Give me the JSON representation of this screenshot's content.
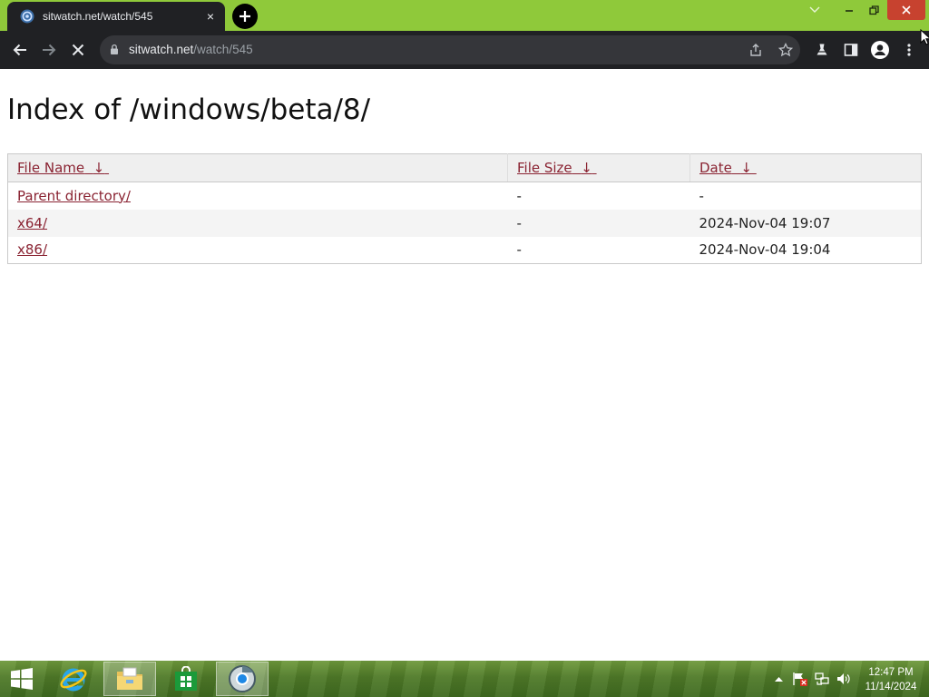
{
  "browser": {
    "tab_title": "sitwatch.net/watch/545",
    "tab_close": "×",
    "new_tab": "+",
    "url_host": "sitwatch.net",
    "url_path": "/watch/545"
  },
  "page": {
    "heading": "Index of /windows/beta/8/",
    "columns": [
      "File Name",
      "File Size",
      "Date"
    ],
    "sort_arrow": "↓",
    "rows": [
      {
        "name": "Parent directory/",
        "size": "-",
        "date": "-"
      },
      {
        "name": "x64/",
        "size": "-",
        "date": "2024-Nov-04 19:07"
      },
      {
        "name": "x86/",
        "size": "-",
        "date": "2024-Nov-04 19:04"
      }
    ]
  },
  "taskbar": {
    "apps": [
      "start-icon",
      "internet-explorer-icon",
      "file-explorer-icon",
      "store-icon",
      "browser-app-icon"
    ],
    "time": "12:47 PM",
    "date": "11/14/2024"
  },
  "colors": {
    "titlebar": "#8fc93a",
    "toolbar": "#202124",
    "link": "#8a2332",
    "close_button": "#c7422f"
  }
}
